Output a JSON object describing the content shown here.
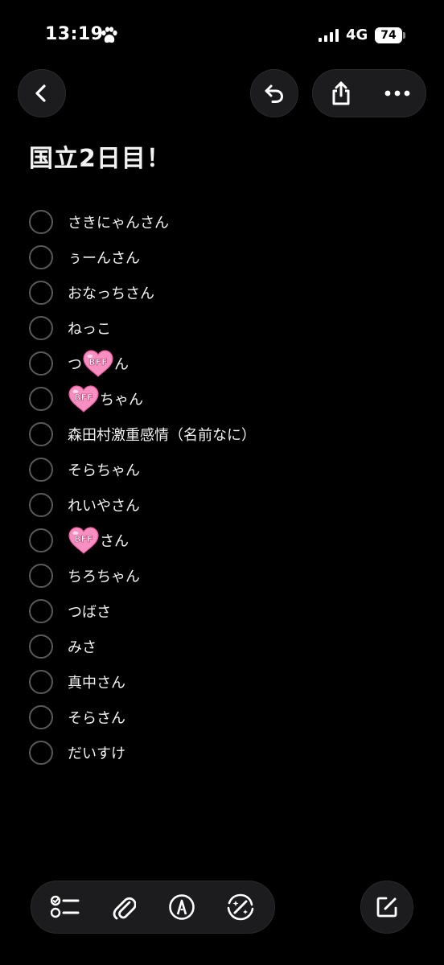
{
  "status_bar": {
    "time": "13:19",
    "time_icon": "paw-icon",
    "network": "4G",
    "battery": "74"
  },
  "nav": {
    "back_icon": "chevron-left-icon",
    "undo_icon": "undo-icon",
    "share_icon": "share-icon",
    "more_icon": "more-icon"
  },
  "note": {
    "title": "国立2日目！",
    "items": [
      {
        "parts": [
          {
            "text": "さきにゃんさん"
          }
        ]
      },
      {
        "parts": [
          {
            "text": "ぅーんさん"
          }
        ]
      },
      {
        "parts": [
          {
            "text": "おなっちさん"
          }
        ]
      },
      {
        "parts": [
          {
            "text": "ねっこ"
          }
        ]
      },
      {
        "parts": [
          {
            "text": "つ"
          },
          {
            "emoji": "BFF"
          },
          {
            "text": "ん"
          }
        ]
      },
      {
        "parts": [
          {
            "emoji": "BFF"
          },
          {
            "text": "ちゃん"
          }
        ]
      },
      {
        "parts": [
          {
            "text": "森田村激重感情（名前なに）"
          }
        ]
      },
      {
        "parts": [
          {
            "text": "そらちゃん"
          }
        ]
      },
      {
        "parts": [
          {
            "text": "れいやさん"
          }
        ]
      },
      {
        "parts": [
          {
            "emoji": "BFF"
          },
          {
            "text": "さん"
          }
        ]
      },
      {
        "parts": [
          {
            "text": "ちろちゃん"
          }
        ]
      },
      {
        "parts": [
          {
            "text": "つばさ"
          }
        ]
      },
      {
        "parts": [
          {
            "text": "みさ"
          }
        ]
      },
      {
        "parts": [
          {
            "text": "真中さん"
          }
        ]
      },
      {
        "parts": [
          {
            "text": "そらさん"
          }
        ]
      },
      {
        "parts": [
          {
            "text": "だいすけ"
          }
        ]
      }
    ]
  },
  "toolbar": {
    "checklist_icon": "checklist-icon",
    "attach_icon": "paperclip-icon",
    "markup_icon": "markup-pen-icon",
    "ai_icon": "writing-tools-icon",
    "compose_icon": "compose-icon"
  },
  "colors": {
    "background": "#000000",
    "button": "#1c1c1e",
    "circle": "#5a5a5c",
    "heart": "#f78fc0",
    "text": "#f2f2f2"
  }
}
